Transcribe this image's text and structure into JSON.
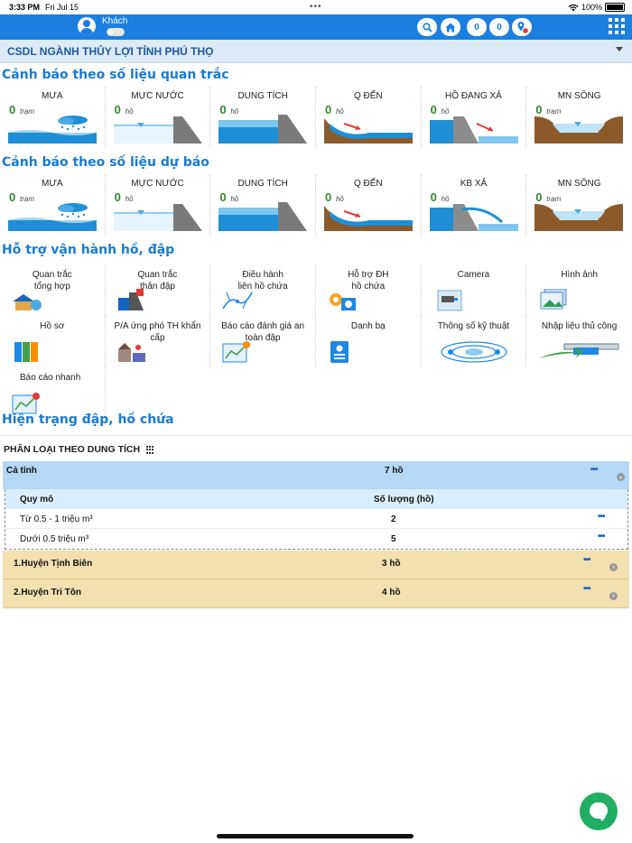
{
  "status_bar": {
    "time": "3:33 PM",
    "date": "Fri Jul 15",
    "battery": "100%"
  },
  "header": {
    "user_label": "Khách",
    "badges": [
      "0",
      "0"
    ],
    "icons": [
      "search-icon",
      "home-icon",
      "location-icon",
      "app-grid-icon"
    ],
    "accent_color": "#1b7fe0"
  },
  "subheader": {
    "title": "CSDL NGÀNH THỦY LỢI TỈNH PHÚ THỌ"
  },
  "observed": {
    "title": "Cảnh báo theo số liệu quan trắc",
    "cards": [
      {
        "label": "MƯA",
        "value": "0",
        "unit": "trạm",
        "icon": "rain-icon"
      },
      {
        "label": "MỰC NƯỚC",
        "value": "0",
        "unit": "hồ",
        "icon": "water-level-icon"
      },
      {
        "label": "DUNG TÍCH",
        "value": "0",
        "unit": "hồ",
        "icon": "capacity-icon"
      },
      {
        "label": "Q ĐẾN",
        "value": "0",
        "unit": "hồ",
        "icon": "inflow-icon"
      },
      {
        "label": "HỒ ĐANG XẢ",
        "value": "0",
        "unit": "hồ",
        "icon": "discharge-icon"
      },
      {
        "label": "MN SÔNG",
        "value": "0",
        "unit": "trạm",
        "icon": "river-level-icon"
      }
    ]
  },
  "forecast": {
    "title": "Cảnh báo theo số liệu dự báo",
    "cards": [
      {
        "label": "MƯA",
        "value": "0",
        "unit": "trạm",
        "icon": "rain-icon"
      },
      {
        "label": "MỰC NƯỚC",
        "value": "0",
        "unit": "hồ",
        "icon": "water-level-icon"
      },
      {
        "label": "DUNG TÍCH",
        "value": "0",
        "unit": "hồ",
        "icon": "capacity-icon"
      },
      {
        "label": "Q ĐẾN",
        "value": "0",
        "unit": "hồ",
        "icon": "inflow-icon"
      },
      {
        "label": "KB XẢ",
        "value": "0",
        "unit": "hồ",
        "icon": "discharge-icon"
      },
      {
        "label": "MN SÔNG",
        "value": "0",
        "unit": "trạm",
        "icon": "river-level-icon"
      }
    ]
  },
  "operations": {
    "title": "Hỗ trợ vận hành hồ, đập",
    "tiles": [
      {
        "label": "Quan trắc\ntổng hợp",
        "icon": "monitoring-summary-icon"
      },
      {
        "label": "Quan trắc\nthân đập",
        "icon": "dam-body-monitoring-icon"
      },
      {
        "label": "Điều hành\nliên hồ chứa",
        "icon": "reservoir-network-icon"
      },
      {
        "label": "Hỗ trợ ĐH\nhồ chứa",
        "icon": "reservoir-support-icon"
      },
      {
        "label": "Camera",
        "icon": "camera-icon"
      },
      {
        "label": "Hình ảnh",
        "icon": "image-icon"
      },
      {
        "label": "Hồ sơ",
        "icon": "records-icon"
      },
      {
        "label": "P/A ứng phó TH khẩn cấp",
        "icon": "emergency-plan-icon"
      },
      {
        "label": "Báo cáo đánh giá an toàn đập",
        "icon": "safety-report-icon"
      },
      {
        "label": "Danh bạ",
        "icon": "contacts-icon"
      },
      {
        "label": "Thông số kỹ thuật",
        "icon": "technical-specs-icon"
      },
      {
        "label": "Nhập liệu thủ công",
        "icon": "manual-input-icon"
      },
      {
        "label": "Báo cáo nhanh",
        "icon": "quick-report-icon"
      }
    ]
  },
  "status": {
    "title": "Hiện trạng đập, hồ chứa",
    "classification_label": "PHÂN LOẠI THEO DUNG TÍCH",
    "province": {
      "label": "Cả tỉnh",
      "count": "7 hồ"
    },
    "columns": [
      "Quy mô",
      "Số lượng (hồ)"
    ],
    "rows": [
      {
        "scale": "Từ 0.5 - 1 triệu m³",
        "count": "2"
      },
      {
        "scale": "Dưới 0.5 triệu m³",
        "count": "5"
      }
    ],
    "districts": [
      {
        "label": "1.Huyện Tịnh Biên",
        "count": "3 hồ"
      },
      {
        "label": "2.Huyện Tri Tôn",
        "count": "4 hồ"
      }
    ],
    "more_label": "•••"
  }
}
